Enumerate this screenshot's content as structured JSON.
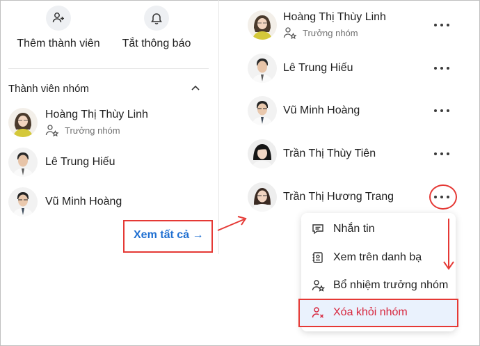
{
  "actions": {
    "add_member": "Thêm thành viên",
    "mute": "Tắt thông báo"
  },
  "members_section": {
    "title": "Thành viên nhóm",
    "see_all": "Xem tất cả",
    "see_all_arrow": "→"
  },
  "members": [
    {
      "name": "Hoàng Thị Thùy Linh",
      "role": "Trưởng nhóm"
    },
    {
      "name": "Lê Trung Hiếu"
    },
    {
      "name": "Vũ Minh Hoàng"
    }
  ],
  "all_members": [
    {
      "name": "Hoàng Thị Thùy Linh",
      "role": "Trưởng nhóm"
    },
    {
      "name": "Lê Trung Hiếu"
    },
    {
      "name": "Vũ Minh Hoàng"
    },
    {
      "name": "Trần Thị Thùy Tiên"
    },
    {
      "name": "Trần Thị Hương Trang"
    }
  ],
  "context_menu": {
    "message": "Nhắn tin",
    "view_contacts": "Xem trên danh bạ",
    "appoint_leader": "Bổ nhiệm trưởng nhóm",
    "remove": "Xóa khỏi nhóm"
  },
  "colors": {
    "accent": "#1f6fd1",
    "danger": "#d7263d",
    "annotation": "#e53935",
    "highlight_bg": "#eaf2fd"
  }
}
